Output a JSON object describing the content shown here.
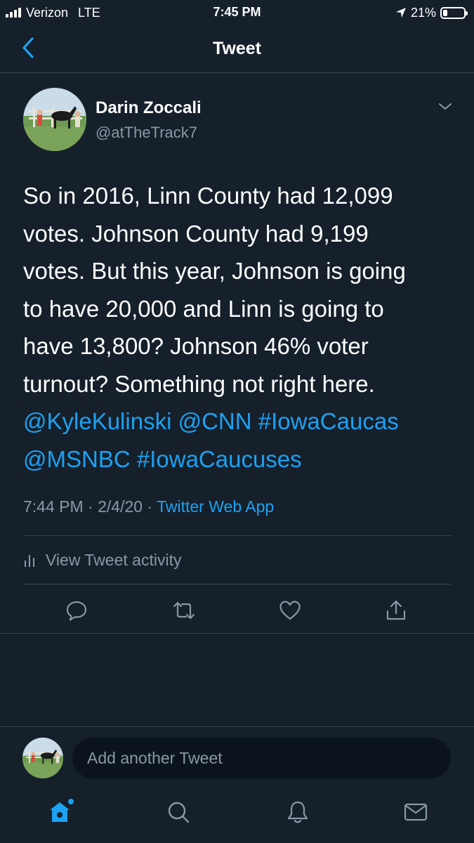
{
  "status_bar": {
    "carrier": "Verizon",
    "network": "LTE",
    "time": "7:45 PM",
    "battery": "21%",
    "battery_level": 0.21,
    "location_icon": "location-arrow-icon"
  },
  "nav": {
    "title": "Tweet",
    "back_icon": "chevron-left-icon"
  },
  "tweet": {
    "author_name": "Darin Zoccali",
    "author_handle": "@atTheTrack7",
    "body_text": "So in 2016, Linn County had 12,099\nvotes. Johnson County had 9,199\nvotes. But this year, Johnson is going\nto have 20,000 and Linn is going to\nhave 13,800? Johnson 46% voter\nturnout? Something not right here.",
    "mentions": [
      "@KyleKulinski",
      "@CNN",
      "#IowaCaucas",
      "@MSNBC",
      "#IowaCaucuses"
    ],
    "time": "7:44 PM",
    "date": "2/4/20",
    "separator": "·",
    "source": "Twitter Web App",
    "activity_label": "View Tweet activity"
  },
  "actions": [
    "reply-icon",
    "retweet-icon",
    "like-icon",
    "share-icon"
  ],
  "reply": {
    "placeholder": "Add another Tweet"
  },
  "tabs": [
    "home-icon",
    "search-icon",
    "notifications-icon",
    "messages-icon"
  ],
  "colors": {
    "background": "#15202b",
    "accent": "#1da1f2",
    "secondary_text": "#8899a6",
    "divider": "#38444d"
  }
}
